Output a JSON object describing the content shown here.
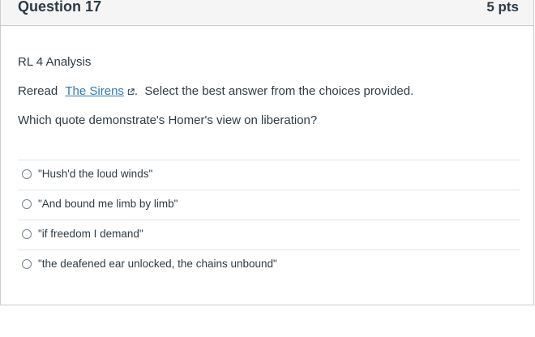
{
  "question": {
    "title": "Question 17",
    "points": "5 pts",
    "analysis_label": "RL 4 Analysis",
    "reread_prefix": "Reread",
    "reread_link_text": "The Sirens",
    "reread_suffix": ".  Select the best answer from the choices provided.",
    "prompt": "Which quote demonstrate's Homer's view on liberation?"
  },
  "answers": [
    {
      "label": "\"Hush'd the loud winds\"",
      "selected": false
    },
    {
      "label": "\"And bound me limb by limb\"",
      "selected": false
    },
    {
      "label": "\"if freedom I demand\"",
      "selected": false
    },
    {
      "label": "\"the deafened ear unlocked, the chains unbound\"",
      "selected": false
    }
  ],
  "icons": {
    "external_link": "external-link-icon"
  },
  "colors": {
    "header_bg": "#f5f5f5",
    "text": "#2d3b45",
    "link": "#2b7abc",
    "border": "#c7cdd1"
  }
}
